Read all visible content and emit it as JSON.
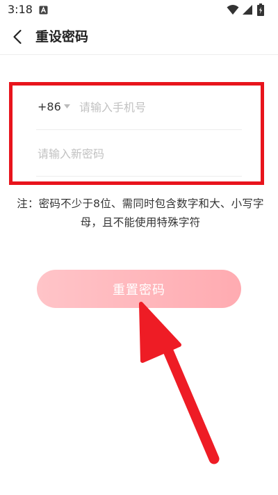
{
  "status_bar": {
    "time": "3:18",
    "icons": [
      "notification-a-icon",
      "wifi-icon",
      "signal-icon",
      "battery-charging-icon"
    ]
  },
  "header": {
    "title": "重设密码",
    "back_icon": "chevron-left-icon"
  },
  "form": {
    "country_code": "+86",
    "phone_placeholder": "请输入手机号",
    "password_placeholder": "请输入新密码",
    "highlight_color": "#e8141c"
  },
  "hint": "注：密码不少于8位、需同时包含数字和大、小写字母，且不能使用特殊字符",
  "reset_button": {
    "label": "重置密码",
    "gradient_start": "#ffc4c8",
    "gradient_end": "#ffabb1"
  },
  "annotation": {
    "arrow_color": "#ee1c25"
  }
}
